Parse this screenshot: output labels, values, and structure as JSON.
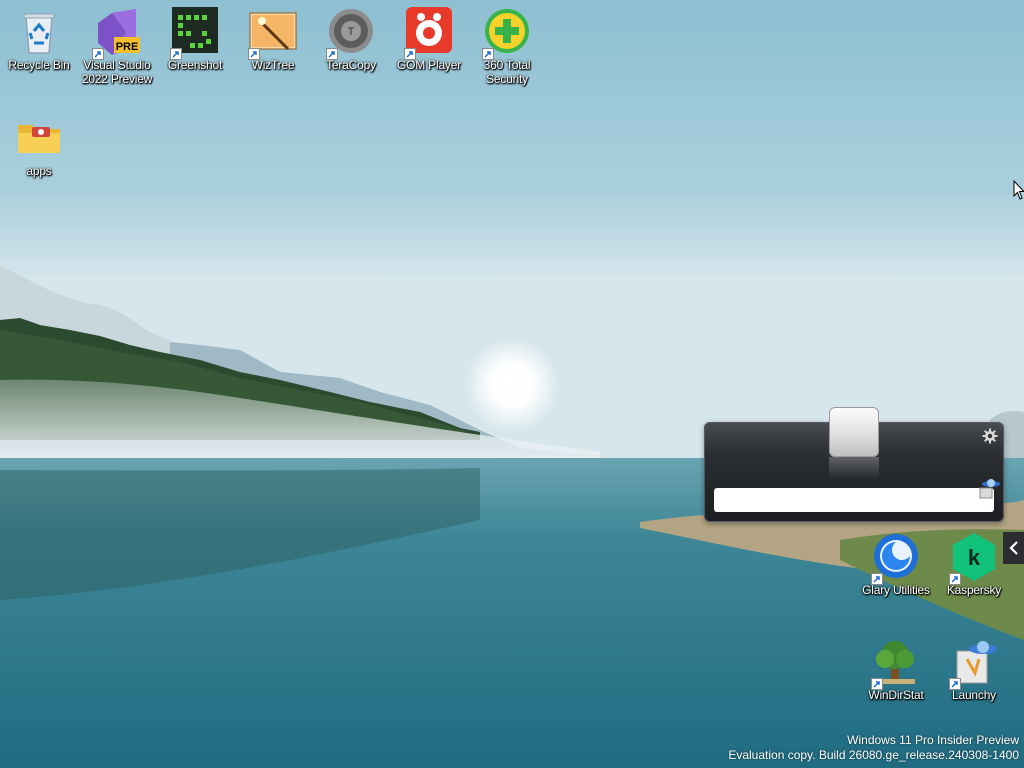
{
  "desktop": {
    "icons": [
      {
        "name": "recycle-bin",
        "label": "Recycle Bin",
        "shortcut": false,
        "icon": "recycle-bin-icon"
      },
      {
        "name": "visual-studio",
        "label": "Visual Studio\n2022 Preview",
        "shortcut": true,
        "icon": "visual-studio-icon",
        "badge": "PRE"
      },
      {
        "name": "greenshot",
        "label": "Greenshot",
        "shortcut": true,
        "icon": "greenshot-icon"
      },
      {
        "name": "wiztree",
        "label": "WizTree",
        "shortcut": true,
        "icon": "wiztree-icon"
      },
      {
        "name": "teracopy",
        "label": "TeraCopy",
        "shortcut": true,
        "icon": "teracopy-icon"
      },
      {
        "name": "gom-player",
        "label": "GOM Player",
        "shortcut": true,
        "icon": "gom-player-icon"
      },
      {
        "name": "360-total-security",
        "label": "360 Total\nSecurity",
        "shortcut": true,
        "icon": "360-security-icon"
      },
      {
        "name": "apps-folder",
        "label": "apps",
        "shortcut": false,
        "icon": "folder-icon"
      },
      {
        "name": "glary-utilities",
        "label": "Glary Utilities",
        "shortcut": true,
        "icon": "glary-utilities-icon"
      },
      {
        "name": "kaspersky",
        "label": "Kaspersky",
        "shortcut": true,
        "icon": "kaspersky-icon"
      },
      {
        "name": "windirstat",
        "label": "WinDirStat",
        "shortcut": true,
        "icon": "windirstat-icon"
      },
      {
        "name": "launchy",
        "label": "Launchy",
        "shortcut": true,
        "icon": "launchy-icon"
      }
    ]
  },
  "launchy_widget": {
    "input_value": "",
    "settings_icon": "gear-icon",
    "catalog_icon": "launchy-satellite-icon"
  },
  "side_panel_toggle": {
    "icon": "chevron-left-icon"
  },
  "watermark": {
    "line1": "Windows 11 Pro Insider Preview",
    "line2": "Evaluation copy. Build 26080.ge_release.240308-1400"
  },
  "colors": {
    "sky_top": "#8dbfd2",
    "sky_horizon": "#d6e6ec",
    "water": "#2f7c8e",
    "launchy_panel": "#25282c",
    "label_text": "#ffffff"
  }
}
